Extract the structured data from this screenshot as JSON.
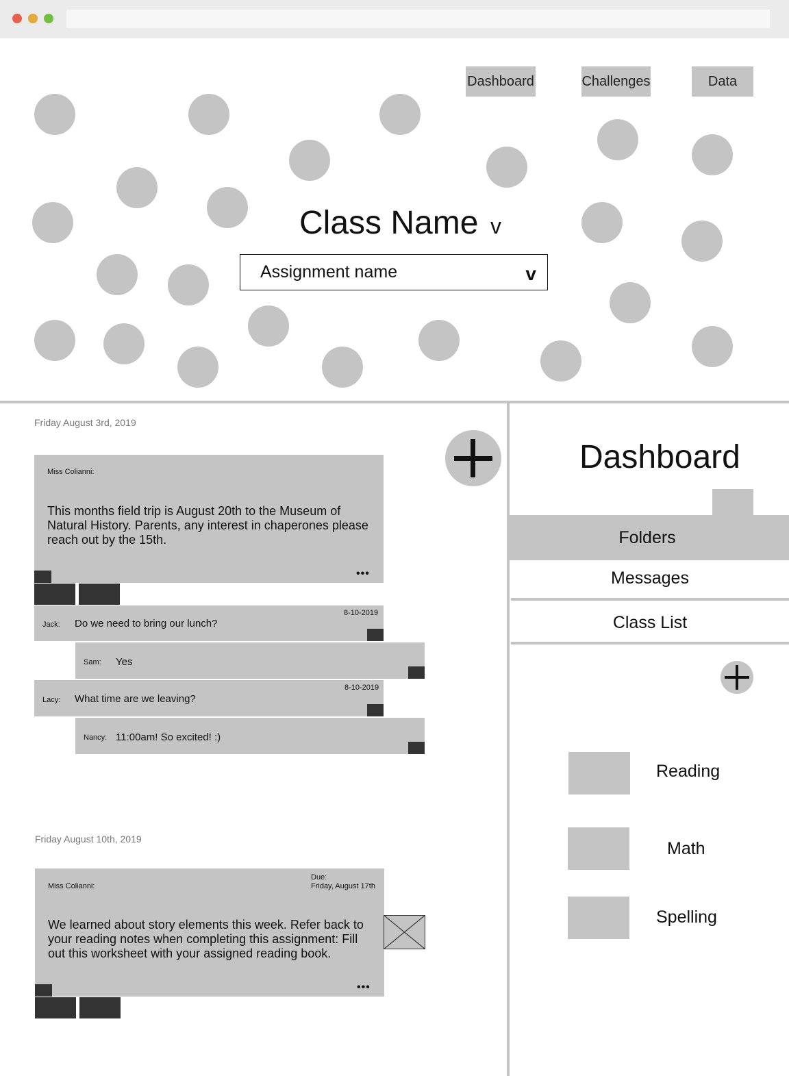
{
  "header": {
    "nav": [
      "Dashboard",
      "Challenges",
      "Data"
    ],
    "class_name": "Class Name",
    "class_caret": "v",
    "assignment": "Assignment name",
    "assignment_caret": "v"
  },
  "feed": {
    "posts": [
      {
        "date": "Friday August 3rd, 2019",
        "author": "Miss Colianni:",
        "body": "This months field trip is August 20th to the Museum of Natural History. Parents, any interest in chaperones please reach out by the 15th.",
        "more": "•••",
        "replies": [
          {
            "who": "Jack:",
            "msg": "Do we need to bring our lunch?",
            "stamp": "8-10-2019"
          },
          {
            "who": "Sam:",
            "msg": "Yes",
            "stamp": ""
          },
          {
            "who": "Lacy:",
            "msg": "What time are we leaving?",
            "stamp": "8-10-2019"
          },
          {
            "who": "Nancy:",
            "msg": "11:00am! So excited! :)",
            "stamp": ""
          }
        ]
      },
      {
        "date": "Friday August 10th, 2019",
        "author": "Miss Colianni:",
        "due_label": "Due:",
        "due_date": "Friday, August 17th",
        "body": "We learned about story elements this week. Refer back to your reading notes when completing this assignment: Fill out this worksheet with your assigned reading book.",
        "more": "•••"
      }
    ]
  },
  "sidebar": {
    "title": "Dashboard",
    "tabs": [
      "Folders",
      "Messages",
      "Class List"
    ],
    "folders": [
      "Reading",
      "Math",
      "Spelling"
    ]
  },
  "icons": {
    "add": "plus-icon",
    "attachment": "image-placeholder-icon",
    "more": "ellipsis-icon",
    "dropdown": "chevron-down-icon"
  },
  "colors": {
    "placeholder": "#c4c4c4",
    "dark_block": "#333333"
  }
}
